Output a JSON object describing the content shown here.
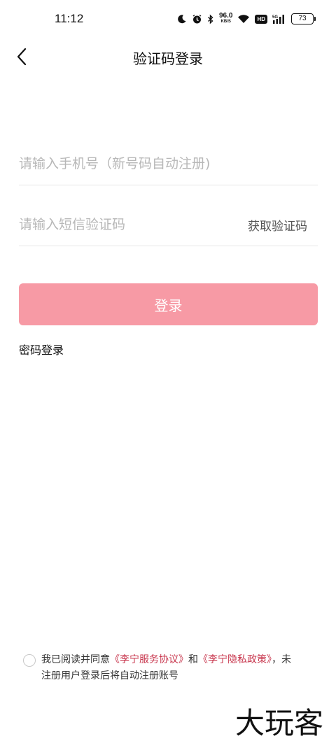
{
  "status_bar": {
    "time": "11:12",
    "net_speed_value": "96.0",
    "net_speed_unit": "KB/S",
    "hd_label": "HD",
    "signal_label": "5G",
    "battery": "73"
  },
  "header": {
    "title": "验证码登录",
    "back_icon": "chevron-left-icon"
  },
  "form": {
    "phone_placeholder": "请输入手机号（新号码自动注册)",
    "phone_value": "",
    "code_placeholder": "请输入短信验证码",
    "code_value": "",
    "get_code_label": "获取验证码",
    "login_label": "登录",
    "password_login_label": "密码登录"
  },
  "agreement": {
    "prefix": "我已阅读并同意",
    "service_link": "《李宁服务协议》",
    "conjunction": "和",
    "privacy_link": "《李宁隐私政策》",
    "suffix": "，未注册用户登录后将自动注册账号",
    "checked": false
  },
  "colors": {
    "accent": "#f79aa5",
    "link": "#c8374e",
    "divider": "#e6e6e6",
    "placeholder": "#b7b7b7"
  },
  "watermark": {
    "text": "大玩客"
  }
}
